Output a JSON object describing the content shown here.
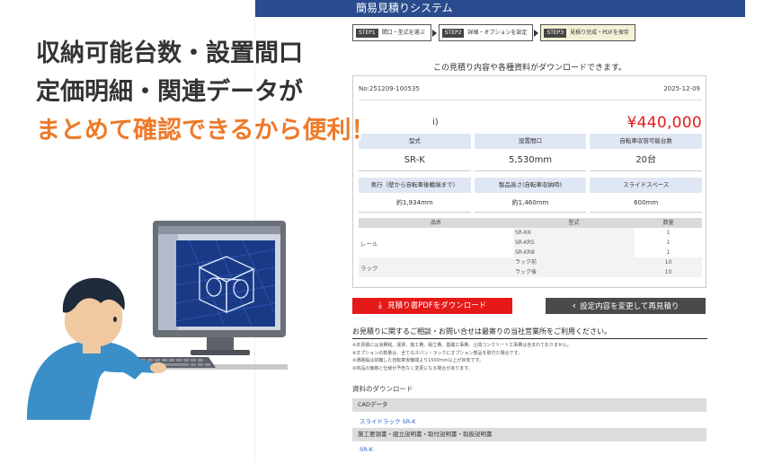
{
  "system_title": "簡易見積りシステム",
  "headline": {
    "line1": "収納可能台数・設置間口",
    "line2": "定価明細・関連データが",
    "line3": "まとめて確認できるから便利！"
  },
  "steps": [
    {
      "num": "STEP1",
      "label": "間口・型式を選ぶ"
    },
    {
      "num": "STEP2",
      "label": "詳細・オプションを設定"
    },
    {
      "num": "STEP3",
      "label": "見積り完成・PDFを保存"
    }
  ],
  "download_note": "この見積り内容や各種資料がダウンロードできます。",
  "quote": {
    "number": "No:251209-100535",
    "date": "2025-12-09",
    "paren": "i)",
    "price": "¥440,000",
    "spec_row1": {
      "headers": [
        "型式",
        "設置間口",
        "自転車収容可能台数"
      ],
      "values": [
        "SR-K",
        "5,530mm",
        "20台"
      ]
    },
    "spec_row2": {
      "headers": [
        "奥行（壁から自転車後輪端まで）",
        "製品高さ(自転車収納時)",
        "スライドスペース"
      ],
      "values": [
        "約1,934mm",
        "約1,460mm",
        "600mm"
      ]
    },
    "parts_headers": [
      "品名",
      "型式",
      "数量"
    ],
    "parts": [
      {
        "group": "レール",
        "items": [
          {
            "model": "SR-K6",
            "qty": "1"
          },
          {
            "model": "SR-KR5",
            "qty": "1"
          },
          {
            "model": "SR-KR8",
            "qty": "1"
          }
        ]
      },
      {
        "group": "ラック",
        "items": [
          {
            "model": "ラック前",
            "qty": "10"
          },
          {
            "model": "ラック後",
            "qty": "10"
          }
        ]
      }
    ]
  },
  "buttons": {
    "pdf": "見積り書PDFをダウンロード",
    "redo": "設定内容を変更して再見積り"
  },
  "contact": "お見積りに関するご相談・お問い合せは最寄りの当社営業所をご利用ください。",
  "notes": [
    "※本見積には消費税、運賃、施工費、組立費、基礎工事費、土間コンクリート工事費は含まれておりません。",
    "※オプションの数量は、全てのスパン・ラックにオプション部品を取付た場合です。",
    "※通路幅は前輪した自転車後輪端より1500mm以上が目安です。",
    "※商品の価格と仕様が予告なく変更になる場合があります。"
  ],
  "downloads": {
    "title": "資料のダウンロード",
    "sections": [
      {
        "label": "CADデータ",
        "link": "スライドラック SR-K"
      },
      {
        "label": "施工要領書・組立説明書・取付説明書・取扱説明書",
        "link": "SR-K"
      }
    ]
  },
  "colors": {
    "header_bg": "#2a4c8e",
    "price_red": "#e21b1b",
    "pdf_button": "#e61919",
    "redo_button": "#4a4a4a",
    "headline_orange": "#ee7a2a",
    "link_blue": "#2a62c9"
  },
  "icons": {
    "pdf": "download-icon",
    "redo": "chevron-left-icon"
  }
}
